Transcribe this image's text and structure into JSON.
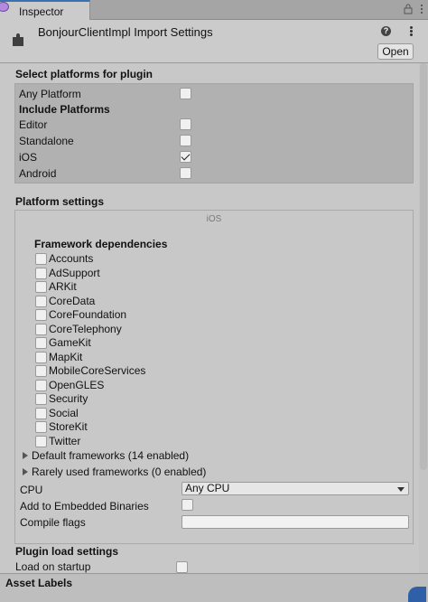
{
  "tab": {
    "title": "Inspector"
  },
  "header": {
    "title": "BonjourClientImpl Import Settings",
    "open_label": "Open"
  },
  "select_platforms": {
    "heading": "Select platforms for plugin",
    "any_platform": {
      "label": "Any Platform",
      "checked": false
    },
    "include_heading": "Include Platforms",
    "platforms": [
      {
        "label": "Editor",
        "checked": false
      },
      {
        "label": "Standalone",
        "checked": false
      },
      {
        "label": "iOS",
        "checked": true
      },
      {
        "label": "Android",
        "checked": false
      }
    ]
  },
  "platform_settings": {
    "heading": "Platform settings",
    "tab_label": "iOS",
    "framework_heading": "Framework dependencies",
    "frameworks": [
      {
        "label": "Accounts",
        "checked": false
      },
      {
        "label": "AdSupport",
        "checked": false
      },
      {
        "label": "ARKit",
        "checked": false
      },
      {
        "label": "CoreData",
        "checked": false
      },
      {
        "label": "CoreFoundation",
        "checked": false
      },
      {
        "label": "CoreTelephony",
        "checked": false
      },
      {
        "label": "GameKit",
        "checked": false
      },
      {
        "label": "MapKit",
        "checked": false
      },
      {
        "label": "MobileCoreServices",
        "checked": false
      },
      {
        "label": "OpenGLES",
        "checked": false
      },
      {
        "label": "Security",
        "checked": false
      },
      {
        "label": "Social",
        "checked": false
      },
      {
        "label": "StoreKit",
        "checked": false
      },
      {
        "label": "Twitter",
        "checked": false
      }
    ],
    "default_frameworks": "Default frameworks (14 enabled)",
    "rarely_used_frameworks": "Rarely used frameworks (0 enabled)",
    "cpu": {
      "label": "CPU",
      "value": "Any CPU"
    },
    "embedded": {
      "label": "Add to Embedded Binaries",
      "checked": false
    },
    "compile_flags": {
      "label": "Compile flags",
      "value": ""
    }
  },
  "plugin_load": {
    "heading": "Plugin load settings",
    "load_on_startup": {
      "label": "Load on startup",
      "checked": false
    }
  },
  "footer": {
    "title": "Asset Labels"
  },
  "colors": {
    "selection_blue": "#3a72b0",
    "panel_gray": "#b1b1b1",
    "background": "#c8c8c8"
  }
}
